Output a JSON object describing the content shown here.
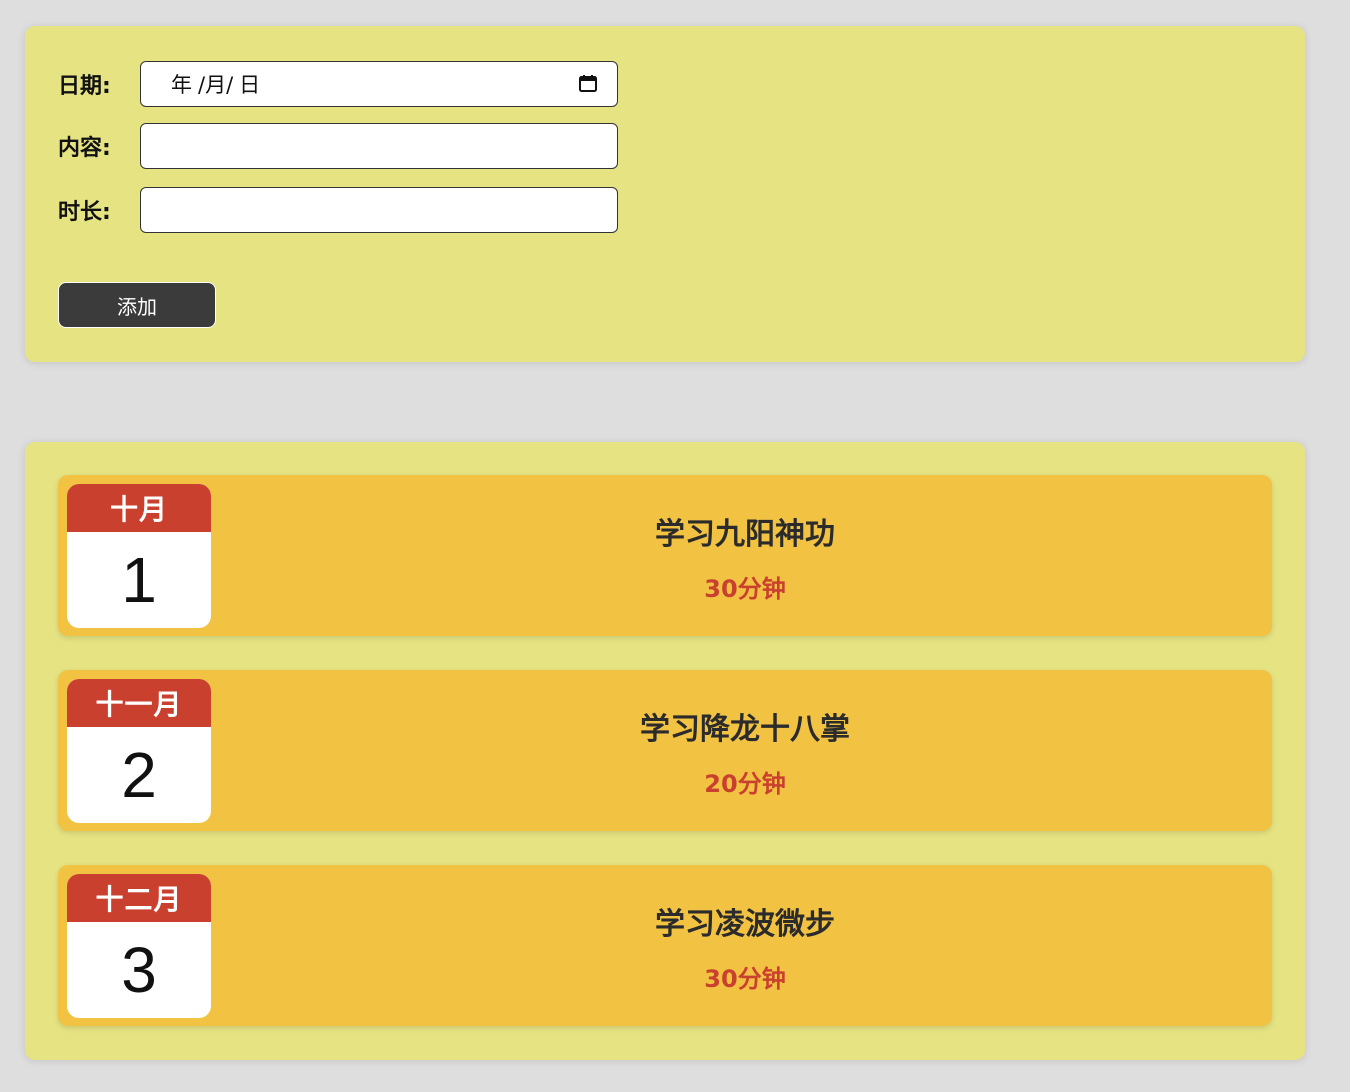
{
  "form": {
    "date_label": "日期:",
    "date_placeholder": {
      "year": "年",
      "month": "/月/",
      "day": "日"
    },
    "content_label": "内容:",
    "content_value": "",
    "duration_label": "时长:",
    "duration_value": "",
    "add_button": "添加"
  },
  "tasks": [
    {
      "month": "十月",
      "day": "1",
      "title": "学习九阳神功",
      "duration": "30分钟"
    },
    {
      "month": "十一月",
      "day": "2",
      "title": "学习降龙十八掌",
      "duration": "20分钟"
    },
    {
      "month": "十二月",
      "day": "3",
      "title": "学习凌波微步",
      "duration": "30分钟"
    }
  ],
  "colors": {
    "page_bg": "#dedede",
    "panel_bg": "#e5e382",
    "card_bg": "#f2c243",
    "accent_red": "#c9402f",
    "button_bg": "#3b3b3b"
  },
  "icons": {
    "date_picker": "calendar-icon"
  }
}
